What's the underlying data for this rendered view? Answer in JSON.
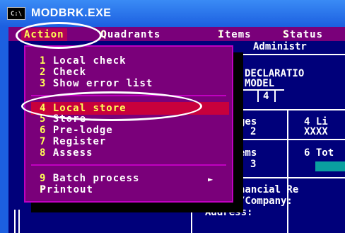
{
  "window": {
    "title": "MODBRK.EXE",
    "icon_label": "C:\\"
  },
  "menubar": {
    "action": "Action",
    "quadrants": "Quadrants",
    "items": "Items",
    "status": "Status"
  },
  "dropdown": {
    "items": [
      {
        "num": "1",
        "label": "Local check"
      },
      {
        "num": "2",
        "label": "Check"
      },
      {
        "num": "3",
        "label": "Show error list"
      },
      {
        "num": "4",
        "label": "Local store"
      },
      {
        "num": "5",
        "label": "Store"
      },
      {
        "num": "6",
        "label": "Pre-lodge"
      },
      {
        "num": "7",
        "label": "Register"
      },
      {
        "num": "8",
        "label": "Assess"
      },
      {
        "num": "9",
        "label": "Batch process"
      },
      {
        "num": "",
        "label": "Printout"
      }
    ],
    "submenu_arrow": "►"
  },
  "background": {
    "administr": "Administr",
    "declaration": "DECLARATIO",
    "model": "MODEL",
    "model_value": "4",
    "ges": "ges",
    "ges_value": "2",
    "li": "4 Li",
    "li_value": "XXXX",
    "ems": "ems",
    "ems_value": "3",
    "tot": "6 Tot",
    "financial": "nancial Re",
    "company": "/Company:",
    "address": "Address:"
  },
  "colors": {
    "menu_bg": "#7a007a",
    "highlight": "#c8003c",
    "console_bg": "#00007a",
    "hotkey": "#ffff55"
  }
}
